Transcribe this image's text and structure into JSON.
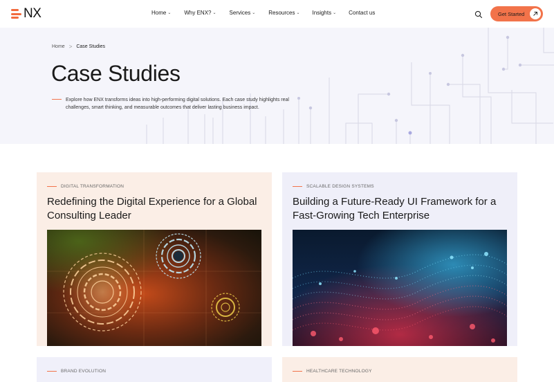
{
  "header": {
    "logo_text": "NX",
    "nav": [
      {
        "label": "Home",
        "has_caret": true
      },
      {
        "label": "Why ENX?",
        "has_caret": true
      },
      {
        "label": "Services",
        "has_caret": true
      },
      {
        "label": "Resources",
        "has_caret": true
      },
      {
        "label": "Insights",
        "has_caret": true
      },
      {
        "label": "Contact us",
        "has_caret": false
      }
    ],
    "search_icon": "search-icon",
    "cta_label": "Get Started",
    "cta_icon": "arrow-up-right-icon"
  },
  "hero": {
    "breadcrumb": {
      "home": "Home",
      "separator": ">",
      "current": "Case Studies"
    },
    "title": "Case Studies",
    "intro": "Explore how ENX transforms ideas into high-performing digital solutions. Each case study highlights real challenges, smart thinking, and measurable outcomes that deliver lasting business impact."
  },
  "cards": [
    {
      "tag": "DIGITAL TRANSFORMATION",
      "title": "Redefining the Digital Experience for a Global Consulting Leader"
    },
    {
      "tag": "SCALABLE DESIGN SYSTEMS",
      "title": "Building a Future-Ready UI Framework for a Fast-Growing Tech Enterprise"
    },
    {
      "tag": "BRAND EVOLUTION",
      "title": ""
    },
    {
      "tag": "HEALTHCARE TECHNOLOGY",
      "title": ""
    }
  ],
  "colors": {
    "accent": "#f2734a",
    "hero_bg": "#f5f5fb",
    "card_warm": "#fbeee6",
    "card_cool": "#efeff9"
  }
}
